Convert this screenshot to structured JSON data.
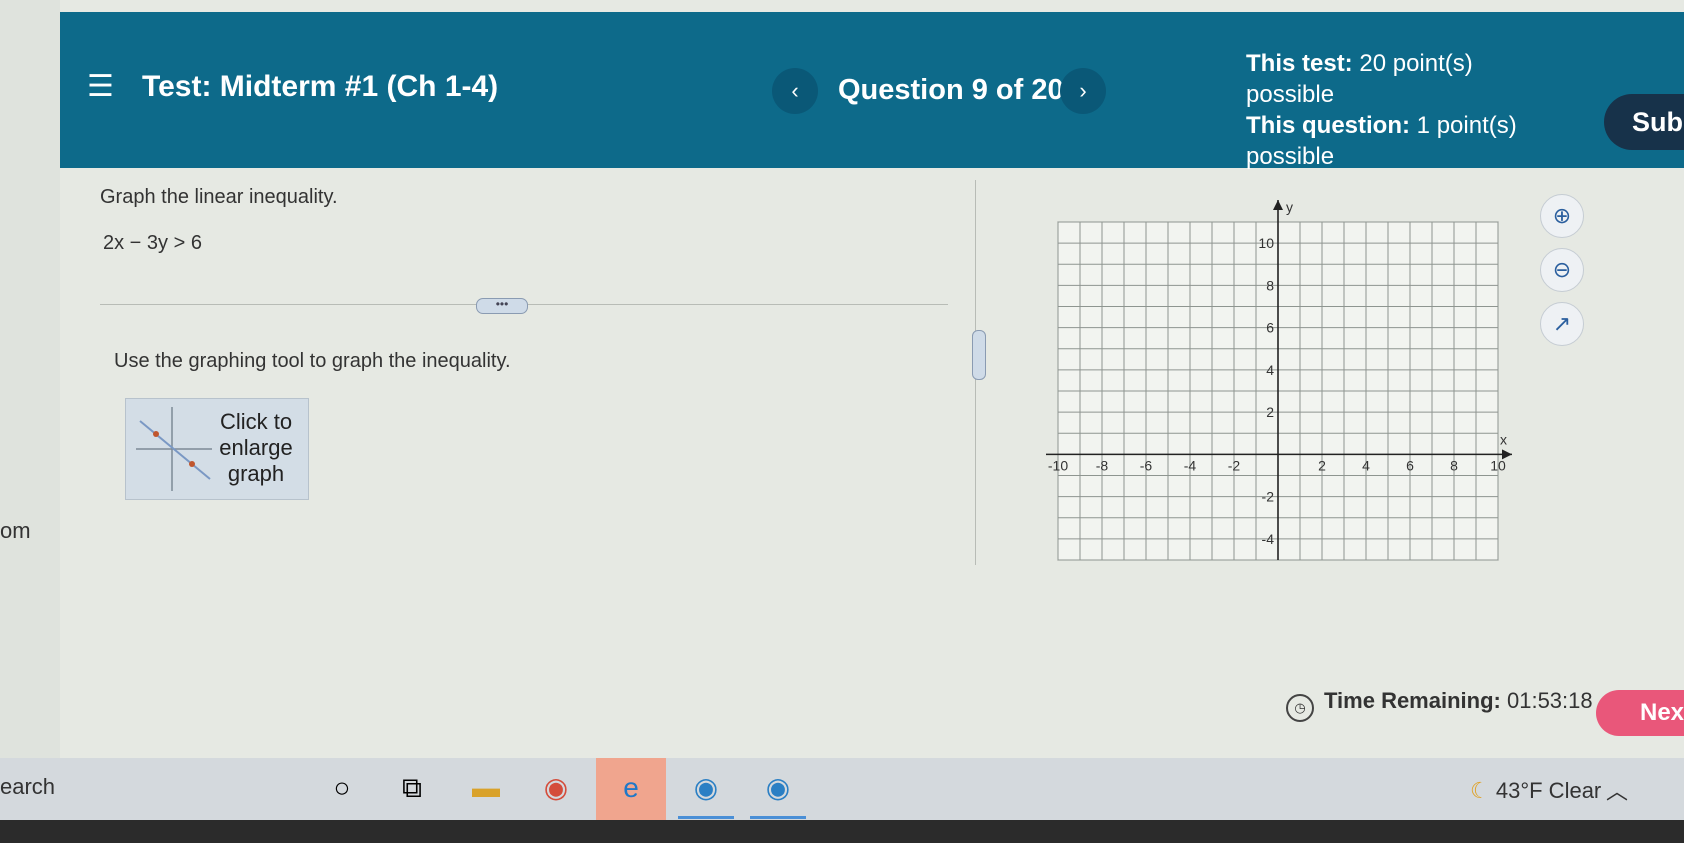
{
  "edge": {
    "left_label": "om"
  },
  "header": {
    "test_title": "Test: Midterm #1 (Ch 1-4)",
    "question_counter": "Question 9 of 20",
    "test_points_label": "This test:",
    "test_points_value": "20 point(s) possible",
    "question_points_label": "This question:",
    "question_points_value": "1 point(s) possible",
    "submit_label": "Sub"
  },
  "question": {
    "prompt": "Graph the linear inequality.",
    "inequality": "2x − 3y > 6",
    "instruction": "Use the graphing tool to graph the inequality.",
    "enlarge_label": "Click to enlarge graph"
  },
  "graph": {
    "x_label": "x",
    "y_label": "y",
    "x_range": [
      -10,
      10
    ],
    "y_range": [
      -5,
      11
    ],
    "x_ticks": [
      -10,
      -8,
      -6,
      -4,
      -2,
      2,
      4,
      6,
      8,
      10
    ],
    "y_ticks": [
      -4,
      -2,
      2,
      4,
      6,
      8,
      10
    ],
    "grid": true,
    "tools": [
      "zoom-in-icon",
      "zoom-out-icon",
      "external-link-icon"
    ]
  },
  "footer": {
    "timer_label": "Time Remaining:",
    "timer_value": "01:53:18",
    "next_label": "Nex"
  },
  "taskbar": {
    "search_text": "earch",
    "weather": "43°F Clear"
  },
  "colors": {
    "header_bg": "#0d6a8a",
    "submit_bg": "#17324a",
    "next_bg": "#e9577a"
  }
}
